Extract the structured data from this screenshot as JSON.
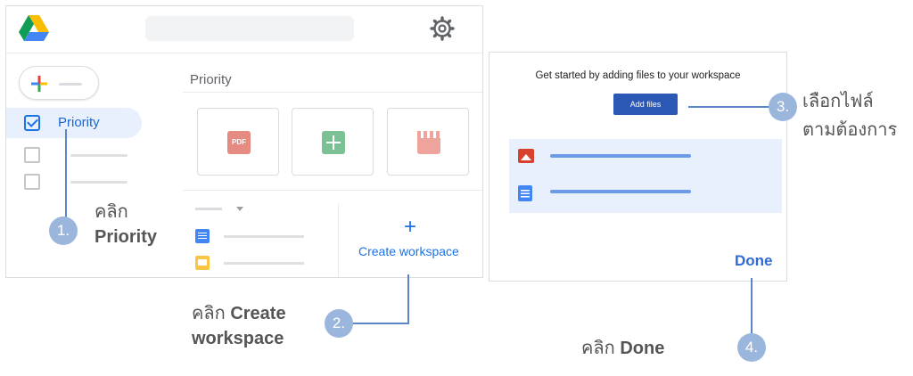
{
  "left_panel": {
    "sidebar": {
      "priority_label": "Priority"
    },
    "main": {
      "section_title": "Priority",
      "cards": [
        {
          "icon": "pdf-file-icon",
          "text": "PDF"
        },
        {
          "icon": "spreadsheet-icon"
        },
        {
          "icon": "video-file-icon"
        }
      ],
      "create_workspace_plus": "+",
      "create_workspace_label": "Create workspace"
    }
  },
  "right_panel": {
    "title": "Get started by adding files to your workspace",
    "add_files_label": "Add files",
    "files": [
      {
        "icon": "image-file-icon"
      },
      {
        "icon": "doc-file-icon"
      }
    ],
    "done_label": "Done"
  },
  "annotations": {
    "step1": {
      "number": "1.",
      "line1": "คลิก",
      "line2": "Priority"
    },
    "step2": {
      "number": "2.",
      "line1_prefix": "คลิก",
      "line1_bold": "Create",
      "line2": "workspace"
    },
    "step3": {
      "number": "3.",
      "line1": "เลือกไฟล์",
      "line2": "ตามต้องการ"
    },
    "step4": {
      "number": "4.",
      "prefix": "คลิก",
      "bold": "Done"
    }
  },
  "colors": {
    "accent": "#1a73e8",
    "callout": "#5a86c6",
    "step_circle": "#9bb6dd",
    "add_files_button": "#2b57b5"
  }
}
